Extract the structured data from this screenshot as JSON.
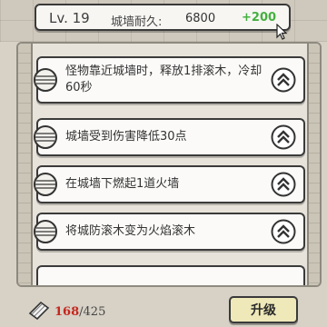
{
  "header": {
    "level": "Lv. 19",
    "durability_label": "城墙耐久:",
    "durability_value": "6800",
    "durability_gain": "+200"
  },
  "skills": [
    {
      "text": "怪物靠近城墙时，释放1排滚木，冷却60秒"
    },
    {
      "text": "城墙受到伤害降低30点"
    },
    {
      "text": "在城墙下燃起1道火墙"
    },
    {
      "text": "将城防滚木变为火焰滚木"
    }
  ],
  "footer": {
    "current": "168",
    "separator": "/",
    "total": "425",
    "upgrade_label": "升级"
  },
  "icons": {
    "skill": "log-roll-icon",
    "upgrade": "chevron-up-icon",
    "resource": "paper-icon",
    "cursor": "cursor-icon"
  },
  "colors": {
    "gain": "#44b040",
    "current_count": "#c5261d",
    "upgrade_button": "#efe8b9"
  }
}
